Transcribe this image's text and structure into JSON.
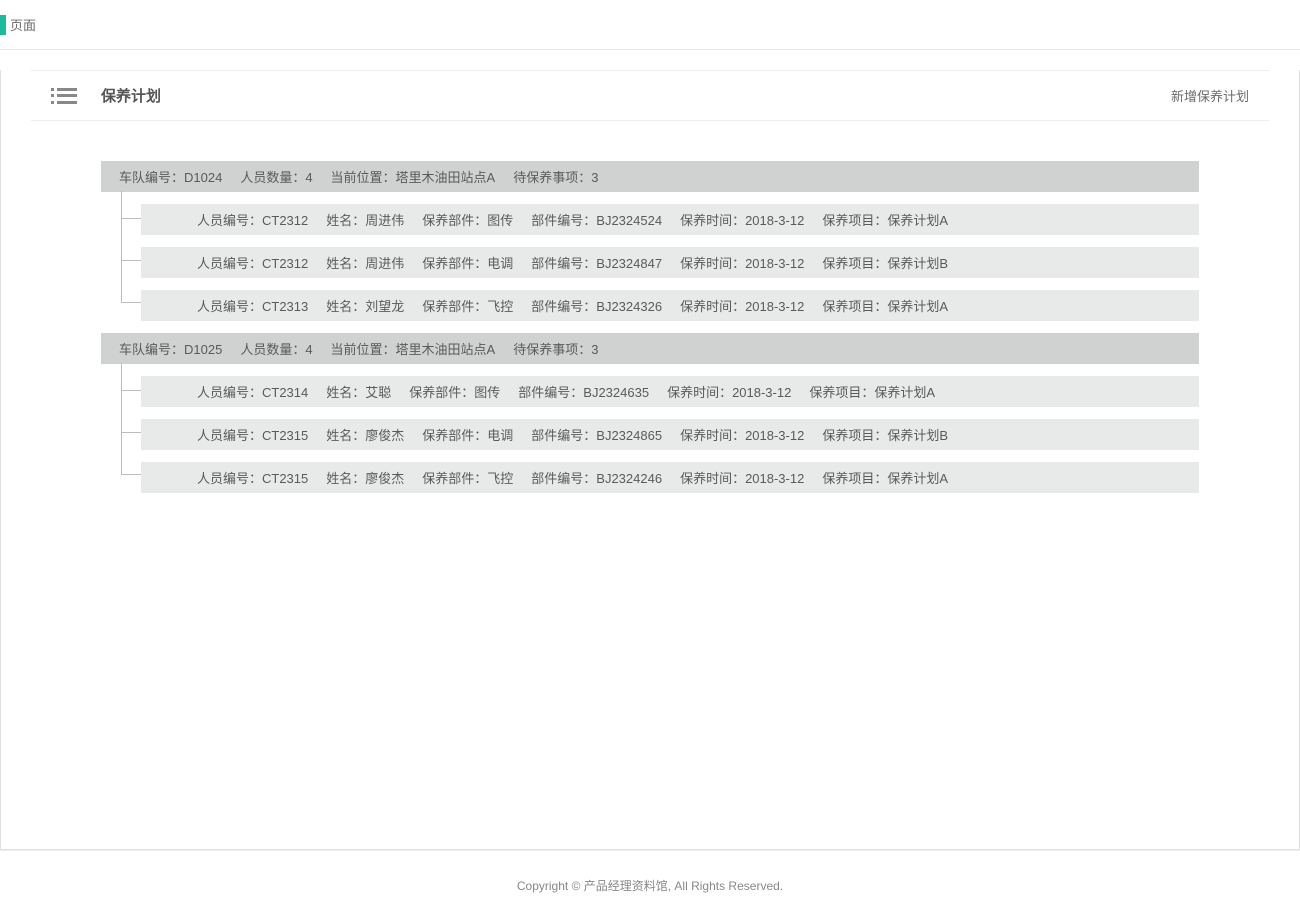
{
  "topbar": {
    "title": "页面"
  },
  "panel": {
    "title": "保养计划",
    "add_button": "新增保养计划"
  },
  "labels": {
    "fleet_id": "车队编号：",
    "person_count": "人员数量：",
    "location": "当前位置：",
    "pending": "待保养事项：",
    "person_id": "人员编号：",
    "name": "姓名：",
    "part": "保养部件：",
    "part_no": "部件编号：",
    "time": "保养时间：",
    "project": "保养项目："
  },
  "groups": [
    {
      "fleet_id": "D1024",
      "person_count": "4",
      "location": "塔里木油田站点A",
      "pending": "3",
      "rows": [
        {
          "person_id": "CT2312",
          "name": "周进伟",
          "part": "图传",
          "part_no": "BJ2324524",
          "time": "2018-3-12",
          "project": "保养计划A"
        },
        {
          "person_id": "CT2312",
          "name": "周进伟",
          "part": "电调",
          "part_no": "BJ2324847",
          "time": "2018-3-12",
          "project": "保养计划B"
        },
        {
          "person_id": "CT2313",
          "name": "刘望龙",
          "part": "飞控",
          "part_no": "BJ2324326",
          "time": "2018-3-12",
          "project": "保养计划A"
        }
      ]
    },
    {
      "fleet_id": "D1025",
      "person_count": "4",
      "location": "塔里木油田站点A",
      "pending": "3",
      "rows": [
        {
          "person_id": "CT2314",
          "name": "艾聪",
          "part": "图传",
          "part_no": "BJ2324635",
          "time": "2018-3-12",
          "project": "保养计划A"
        },
        {
          "person_id": "CT2315",
          "name": "廖俊杰",
          "part": "电调",
          "part_no": "BJ2324865",
          "time": "2018-3-12",
          "project": "保养计划B"
        },
        {
          "person_id": "CT2315",
          "name": "廖俊杰",
          "part": "飞控",
          "part_no": "BJ2324246",
          "time": "2018-3-12",
          "project": "保养计划A"
        }
      ]
    }
  ],
  "footer": "Copyright © 产品经理资料馆, All Rights Reserved."
}
